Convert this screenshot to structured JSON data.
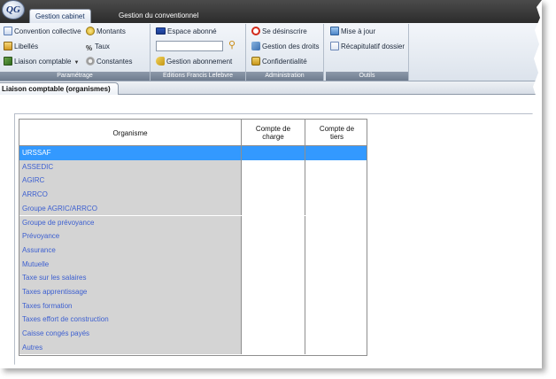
{
  "app": {
    "logo_text": "QG",
    "tabs": [
      {
        "label": "Gestion cabinet",
        "active": true
      },
      {
        "label": "Gestion du conventionnel",
        "active": false
      }
    ]
  },
  "ribbon": {
    "groups": {
      "parametrage": {
        "label": "Paramétrage",
        "items": {
          "convention": "Convention collective",
          "montants": "Montants",
          "libelles": "Libellés",
          "taux": "Taux",
          "liaison": "Liaison comptable",
          "constantes": "Constantes"
        }
      },
      "editions": {
        "label": "Editions Francis Lefebvre",
        "items": {
          "espace": "Espace abonné",
          "search_value": "",
          "gestion_abonnement": "Gestion abonnement"
        }
      },
      "administration": {
        "label": "Administration",
        "items": {
          "desinscrire": "Se désinscrire",
          "droits": "Gestion des droits",
          "confidentialite": "Confidentialité"
        }
      },
      "outils": {
        "label": "Outils",
        "items": {
          "mise_a_jour": "Mise à jour",
          "recap": "Récapitulatif dossier"
        }
      }
    }
  },
  "document_tab": {
    "label": "Liaison comptable (organismes)"
  },
  "grid": {
    "columns": {
      "organisme": "Organisme",
      "compte_charge": "Compte de charge",
      "compte_tiers": "Compte de tiers"
    },
    "rows": [
      {
        "organisme": "URSSAF",
        "selected": true
      },
      {
        "organisme": "ASSEDIC"
      },
      {
        "organisme": "AGIRC"
      },
      {
        "organisme": "ARRCO"
      },
      {
        "organisme": "Groupe AGRIC/ARRCO"
      },
      {
        "organisme": "Groupe de prévoyance"
      },
      {
        "organisme": "Prévoyance"
      },
      {
        "organisme": "Assurance"
      },
      {
        "organisme": "Mutuelle"
      },
      {
        "organisme": "Taxe sur les salaires"
      },
      {
        "organisme": "Taxes apprentissage"
      },
      {
        "organisme": "Taxes formation"
      },
      {
        "organisme": "Taxes effort de construction"
      },
      {
        "organisme": "Caisse congés payés"
      },
      {
        "organisme": "Autres"
      }
    ]
  },
  "colors": {
    "selected_row": "#3399ff",
    "link_text": "#3c5fd0",
    "first_column_bg": "#d4d4d4"
  }
}
